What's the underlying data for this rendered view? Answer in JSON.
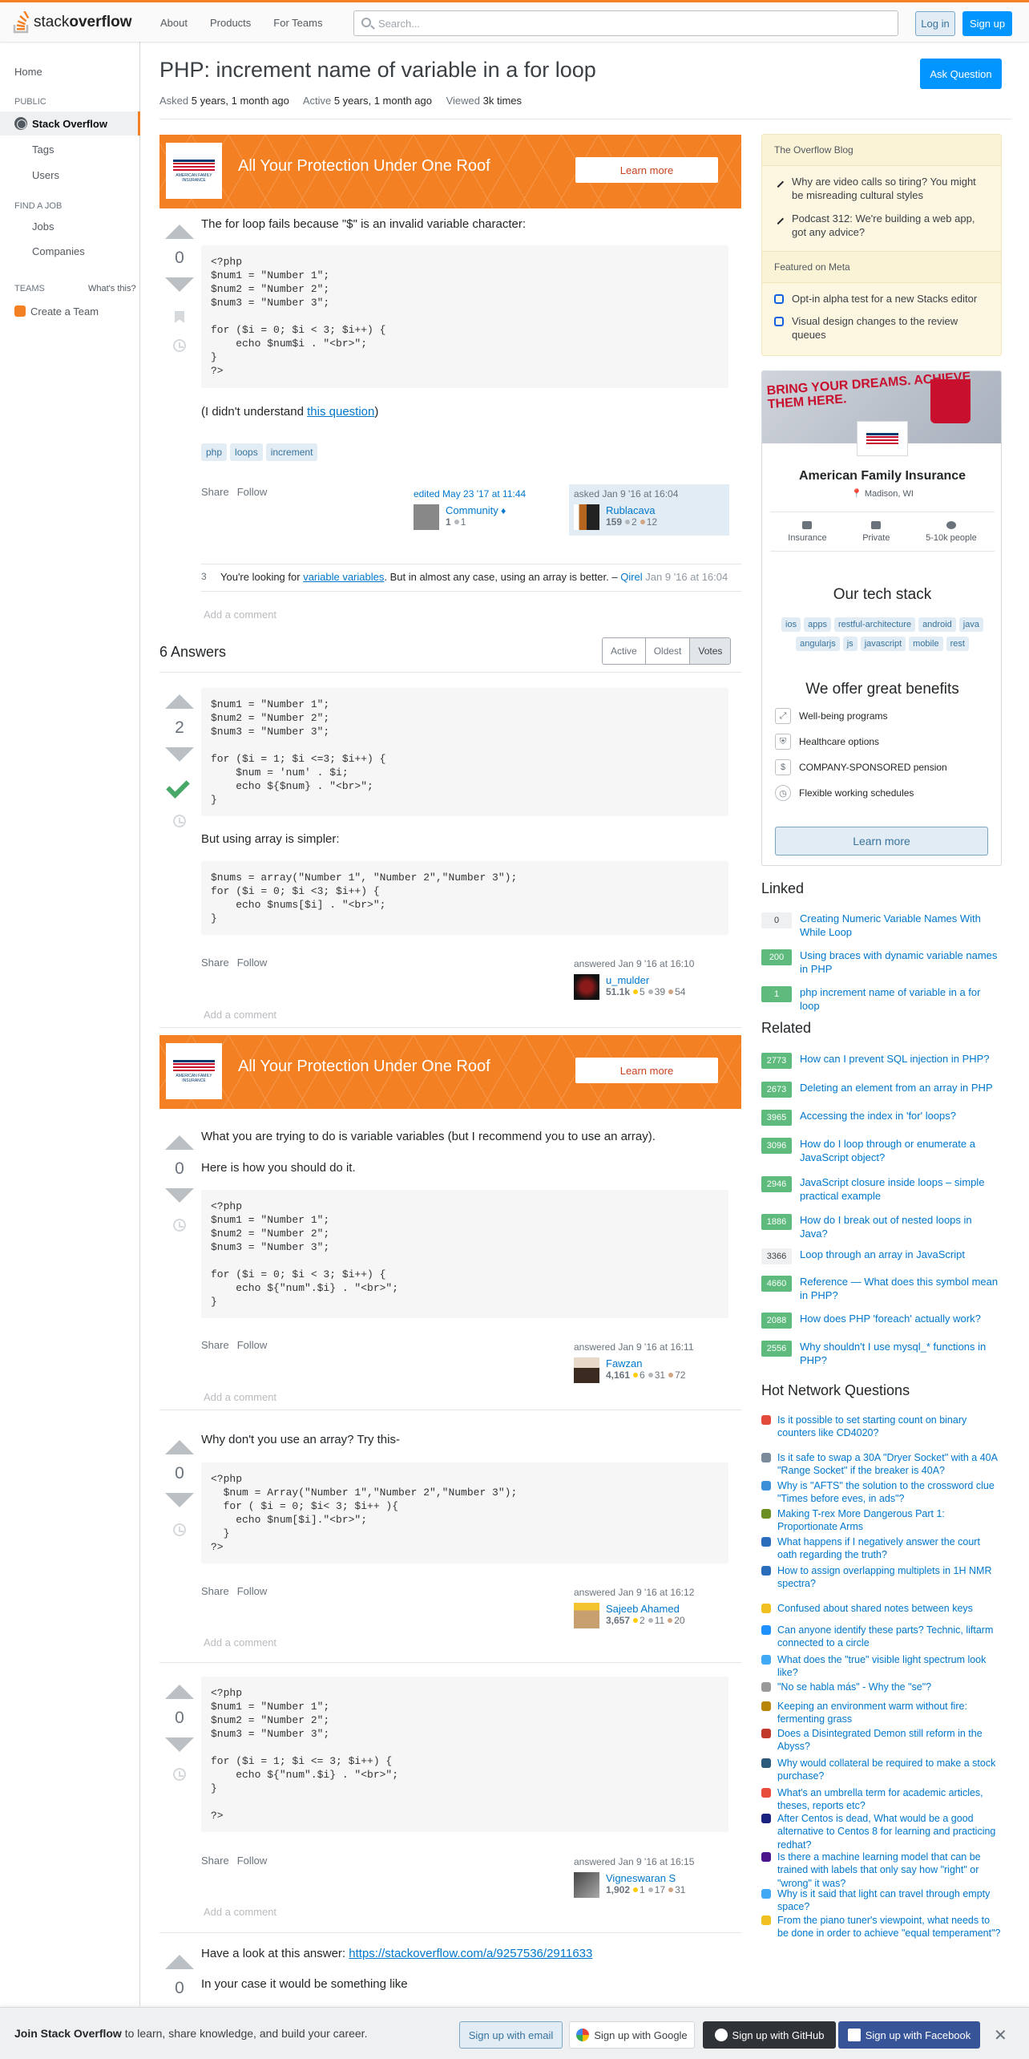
{
  "header": {
    "logo_light": "stack",
    "logo_bold": "overflow",
    "nav": [
      "About",
      "Products",
      "For Teams"
    ],
    "search_placeholder": "Search...",
    "login": "Log in",
    "signup": "Sign up",
    "accent": "#f48024"
  },
  "leftnav": {
    "home": "Home",
    "public": "PUBLIC",
    "stackoverflow": "Stack Overflow",
    "tags": "Tags",
    "users": "Users",
    "findjob": "FIND A JOB",
    "jobs": "Jobs",
    "companies": "Companies",
    "teams": "TEAMS",
    "whats": "What's this?",
    "create_team": "Create a Team"
  },
  "question": {
    "title": "PHP: increment name of variable in a for loop",
    "ask_button": "Ask Question",
    "asked_label": "Asked",
    "asked_value": "5 years, 1 month ago",
    "active_label": "Active",
    "active_value": "5 years, 1 month ago",
    "viewed_label": "Viewed",
    "viewed_value": "3k times",
    "votes": "0",
    "intro": "The for loop fails because \"$\" is an invalid variable character:",
    "code": [
      "<?php",
      "$num1 = \"Number 1\";",
      "$num2 = \"Number 2\";",
      "$num3 = \"Number 3\";",
      "",
      "for ($i = 0; $i < 3; $i++) {",
      "    echo $num$i . \"<br>\";",
      "}",
      "?>"
    ],
    "understand_pre": "(I didn't understand ",
    "understand_link": "this question",
    "understand_post": ")",
    "tags": [
      "php",
      "loops",
      "increment"
    ],
    "share": "Share",
    "follow": "Follow",
    "edited": "edited May 23 '17 at 11:44",
    "editor": "Community",
    "editor_diamond": "♦",
    "editor_rep": "1",
    "editor_silver": "1",
    "asked_sig": "asked Jan 9 '16 at 16:04",
    "asker": "Rublacava",
    "asker_rep": "159",
    "asker_silver": "2",
    "asker_bronze": "12",
    "comment_score": "3",
    "comment_pre": "You're looking for ",
    "comment_link": "variable variables",
    "comment_post": ". But in almost any case, using an array is better. –",
    "comment_user": "Qirel",
    "comment_date": "Jan 9 '16 at 16:04",
    "add_comment": "Add a comment"
  },
  "ad": {
    "title": "All Your Protection Under One Roof",
    "button": "Learn more",
    "logo_text": "AMERICAN FAMILY INSURANCE"
  },
  "answers_header": {
    "count": "6 Answers",
    "sort": [
      "Active",
      "Oldest",
      "Votes"
    ]
  },
  "answers": [
    {
      "votes": "2",
      "code1": [
        "$num1 = \"Number 1\";",
        "$num2 = \"Number 2\";",
        "$num3 = \"Number 3\";",
        "",
        "for ($i = 1; $i <=3; $i++) {",
        "    $num = 'num' . $i;",
        "    echo ${$num} . \"<br>\";",
        "}"
      ],
      "text2": "But using array is simpler:",
      "code2": [
        "$nums = array(\"Number 1\", \"Number 2\",\"Number 3\");",
        "for ($i = 0; $i <3; $i++) {",
        "    echo $nums[$i] . \"<br>\";",
        "}"
      ],
      "answered": "answered Jan 9 '16 at 16:10",
      "user": "u_mulder",
      "rep": "51.1k",
      "gold": "5",
      "silver": "39",
      "bronze": "54"
    },
    {
      "votes": "0",
      "text1": "What you are trying to do is variable variables (but I recommend you to use an array).",
      "text2": "Here is how you should do it.",
      "code1": [
        "<?php",
        "$num1 = \"Number 1\";",
        "$num2 = \"Number 2\";",
        "$num3 = \"Number 3\";",
        "",
        "for ($i = 0; $i < 3; $i++) {",
        "    echo ${\"num\".$i} . \"<br>\";",
        "}"
      ],
      "answered": "answered Jan 9 '16 at 16:11",
      "user": "Fawzan",
      "rep": "4,161",
      "gold": "6",
      "silver": "31",
      "bronze": "72"
    },
    {
      "votes": "0",
      "text1": "Why don't you use an array? Try this-",
      "code1": [
        "<?php",
        "  $num = Array(\"Number 1\",\"Number 2\",\"Number 3\");",
        "  for ( $i = 0; $i< 3; $i++ ){",
        "    echo $num[$i].\"<br>\";",
        "  }",
        "?>"
      ],
      "answered": "answered Jan 9 '16 at 16:12",
      "user": "Sajeeb Ahamed",
      "rep": "3,657",
      "gold": "2",
      "silver": "11",
      "bronze": "20"
    },
    {
      "votes": "0",
      "code1": [
        "<?php",
        "$num1 = \"Number 1\";",
        "$num2 = \"Number 2\";",
        "$num3 = \"Number 3\";",
        "",
        "for ($i = 1; $i <= 3; $i++) {",
        "    echo ${\"num\".$i} . \"<br>\";",
        "}",
        "",
        "?>"
      ],
      "answered": "answered Jan 9 '16 at 16:15",
      "user": "Vigneswaran S",
      "rep": "1,902",
      "gold": "1",
      "silver": "17",
      "bronze": "31"
    },
    {
      "votes": "0",
      "text_pre": "Have a look at this answer: ",
      "text_link": "https://stackoverflow.com/a/9257536/2911633",
      "text2": "In your case it would be something like"
    }
  ],
  "blog": {
    "title": "The Overflow Blog",
    "items": [
      "Why are video calls so tiring? You might be misreading cultural styles",
      "Podcast 312: We're building a web app, got any advice?"
    ],
    "meta_title": "Featured on Meta",
    "meta_items": [
      "Opt-in alpha test for a new Stacks editor",
      "Visual design changes to the review queues"
    ]
  },
  "company": {
    "banner_text": "BRING YOUR DREAMS. ACHIEVE THEM HERE.",
    "name": "American Family Insurance",
    "location": "Madison, WI",
    "stats": [
      "Insurance",
      "Private",
      "5-10k people"
    ],
    "stack_title": "Our tech stack",
    "tech": [
      "ios",
      "apps",
      "restful-architecture",
      "android",
      "java",
      "angularjs",
      "js",
      "javascript",
      "mobile",
      "rest"
    ],
    "benefits_title": "We offer great benefits",
    "benefits": [
      "Well-being programs",
      "Healthcare options",
      "COMPANY-SPONSORED pension",
      "Flexible working schedules"
    ],
    "learn": "Learn more"
  },
  "linked": {
    "title": "Linked",
    "items": [
      {
        "score": "0",
        "text": "Creating Numeric Variable Names With While Loop"
      },
      {
        "score": "200",
        "text": "Using braces with dynamic variable names in PHP"
      },
      {
        "score": "1",
        "text": "php increment name of variable in a for loop"
      }
    ]
  },
  "related": {
    "title": "Related",
    "items": [
      {
        "score": "2773",
        "text": "How can I prevent SQL injection in PHP?"
      },
      {
        "score": "2673",
        "text": "Deleting an element from an array in PHP"
      },
      {
        "score": "3965",
        "text": "Accessing the index in 'for' loops?"
      },
      {
        "score": "3096",
        "text": "How do I loop through or enumerate a JavaScript object?"
      },
      {
        "score": "2946",
        "text": "JavaScript closure inside loops – simple practical example"
      },
      {
        "score": "1886",
        "text": "How do I break out of nested loops in Java?"
      },
      {
        "score": "3366",
        "text": "Loop through an array in JavaScript"
      },
      {
        "score": "4660",
        "text": "Reference — What does this symbol mean in PHP?"
      },
      {
        "score": "2088",
        "text": "How does PHP 'foreach' actually work?"
      },
      {
        "score": "2556",
        "text": "Why shouldn't I use mysql_* functions in PHP?"
      }
    ]
  },
  "hnq": {
    "title": "Hot Network Questions",
    "items": [
      "Is it possible to set starting count on binary counters like CD4020?",
      "Is it safe to swap a 30A \"Dryer Socket\" with a 40A \"Range Socket\" if the breaker is 40A?",
      "Why is \"AFTS\" the solution to the crossword clue \"Times before eves, in ads\"?",
      "Making T-rex More Dangerous Part 1: Proportionate Arms",
      "What happens if I negatively answer the court oath regarding the truth?",
      "How to assign overlapping multiplets in 1H NMR spectra?",
      "Confused about shared notes between keys",
      "Can anyone identify these parts? Technic, liftarm connected to a circle",
      "What does the \"true\" visible light spectrum look like?",
      "\"No se habla más\" - Why the \"se\"?",
      "Keeping an environment warm without fire: fermenting grass",
      "Does a Disintegrated Demon still reform in the Abyss?",
      "Why would collateral be required to make a stock purchase?",
      "What's an umbrella term for academic articles, theses, reports etc?",
      "After Centos is dead, What would be a good alternative to Centos 8 for learning and practicing redhat?",
      "Is there a machine learning model that can be trained with labels that only say how \"right\" or \"wrong\" it was?",
      "Why is it said that light can travel through empty space?",
      "From the piano tuner's viewpoint, what needs to be done in order to achieve \"equal temperament\"?"
    ],
    "colors": [
      "#e24a3a",
      "#7a8a9a",
      "#3d8fd8",
      "#6b8e23",
      "#2a6ebb",
      "#2a6ebb",
      "#f0c020",
      "#1e90ff",
      "#3fa9f5",
      "#999999",
      "#b8860b",
      "#c0392b",
      "#2c5a7a",
      "#e74c3c",
      "#1a237e",
      "#4a148c",
      "#3fa9f5",
      "#f0c020"
    ]
  },
  "footer": {
    "join": "Join Stack Overflow",
    "join_rest": " to learn, share knowledge, and build your career.",
    "email": "Sign up with email",
    "google": "Sign up with Google",
    "github": "Sign up with GitHub",
    "facebook": "Sign up with Facebook",
    "close": "✕"
  }
}
